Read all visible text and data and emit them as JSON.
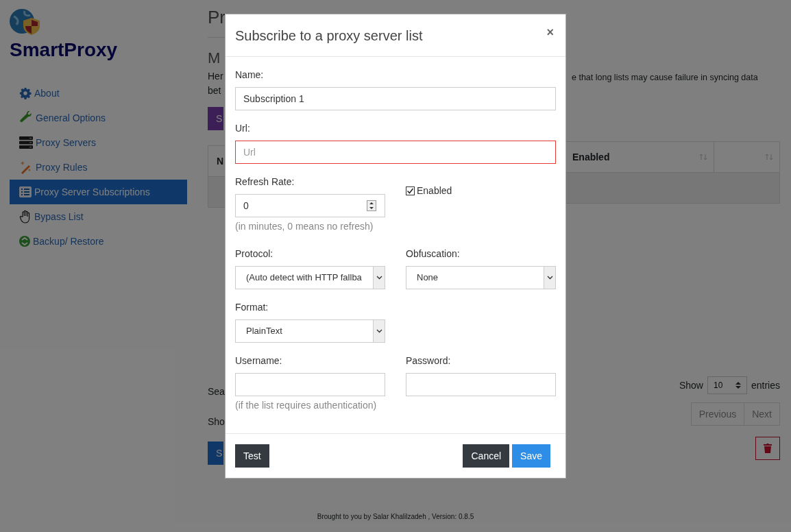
{
  "sidebar": {
    "brand": "SmartProxy",
    "items": [
      {
        "label": "About",
        "kind": "gear",
        "selected": false
      },
      {
        "label": "General Options",
        "kind": "wrench",
        "selected": false
      },
      {
        "label": "Proxy Servers",
        "kind": "server",
        "selected": false
      },
      {
        "label": "Proxy Rules",
        "kind": "wand",
        "selected": false
      },
      {
        "label": "Proxy Server Subscriptions",
        "kind": "list",
        "selected": true
      },
      {
        "label": "Bypass List",
        "kind": "hand",
        "selected": false
      },
      {
        "label": "Backup/ Restore",
        "kind": "backup",
        "selected": false
      }
    ]
  },
  "page": {
    "title": "Pr",
    "section_heading": "M",
    "description_left": [
      "Her",
      "bet"
    ],
    "description_right": "e that long lists may cause failure in syncing data",
    "add_button": "S",
    "table": {
      "column_1": "N",
      "column_right": "Enabled"
    },
    "search_label": "Sea",
    "length": {
      "label": "Show",
      "value": "10",
      "suffix": "entries"
    },
    "info": "Sho",
    "pagination": [
      "Previous",
      "Next"
    ],
    "save_button": "S"
  },
  "modal": {
    "title": "Subscribe to a proxy server list",
    "close": "×",
    "name": {
      "label": "Name:",
      "value": "Subscription 1"
    },
    "url": {
      "label": "Url:",
      "placeholder": "Url",
      "invalid": true
    },
    "refresh_rate": {
      "label": "Refresh Rate:",
      "value": "0",
      "hint": "(in minutes, 0 means no refresh)"
    },
    "enabled": {
      "label": "Enabled",
      "checked": true
    },
    "protocol": {
      "label": "Protocol:",
      "value": "(Auto detect with HTTP fallba"
    },
    "obfuscation": {
      "label": "Obfuscation:",
      "value": "None"
    },
    "format": {
      "label": "Format:",
      "value": "PlainText"
    },
    "username": {
      "label": "Username:",
      "hint": "(if the list requires authentication)"
    },
    "password": {
      "label": "Password:"
    },
    "buttons": {
      "test": "Test",
      "cancel": "Cancel",
      "save": "Save"
    }
  },
  "footer": "Brought to you by Salar Khalilzadeh , Version: 0.8.5"
}
